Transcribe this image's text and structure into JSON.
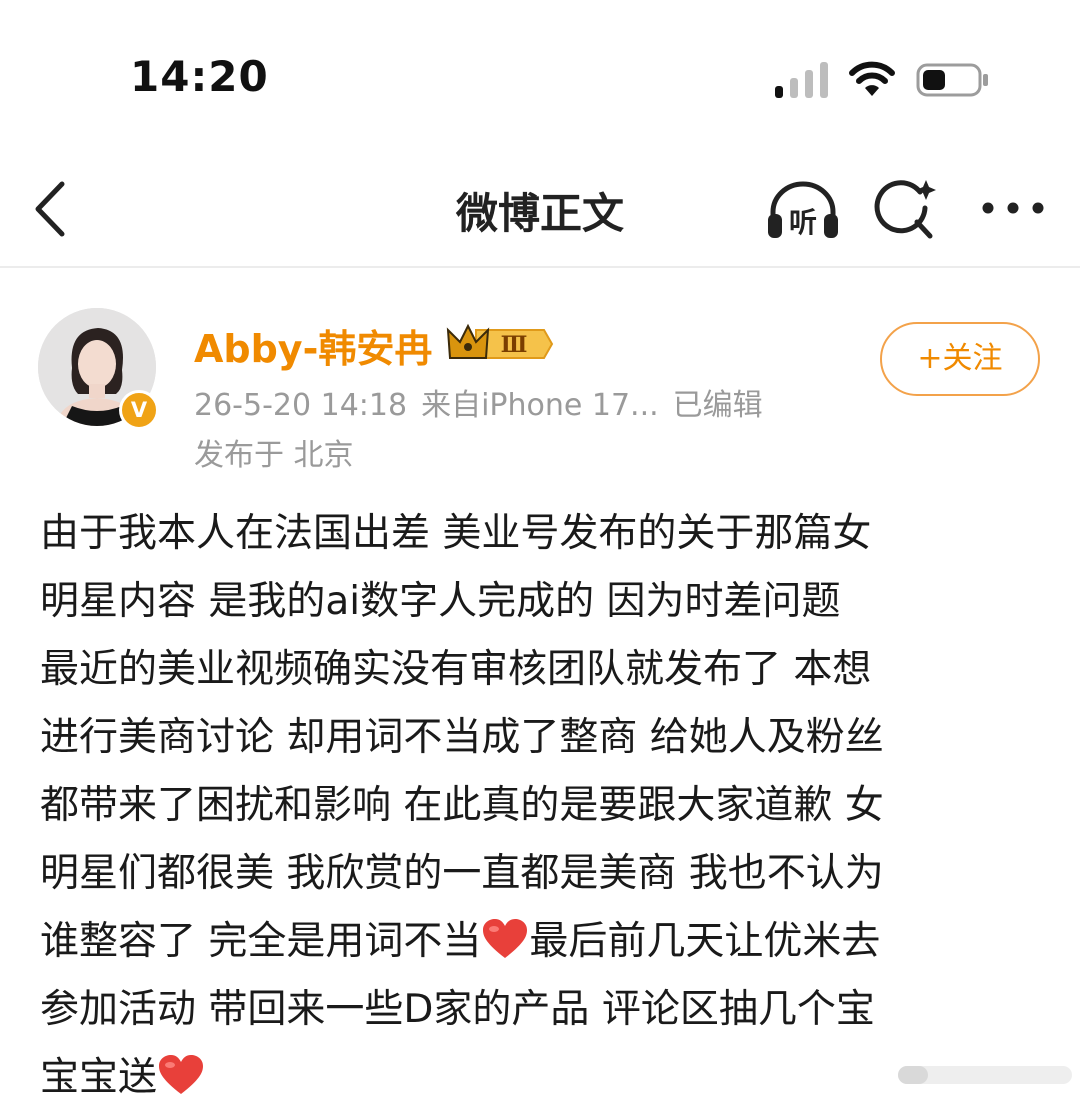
{
  "status_bar": {
    "time": "14:20"
  },
  "nav": {
    "title": "微博正文",
    "listen_label": "听"
  },
  "post": {
    "author": "Abby-韩安冉",
    "vip_level": "Ⅲ",
    "follow_label": "+关注",
    "time": "26-5-20 14:18",
    "source": "来自iPhone 17...",
    "edited": "已编辑",
    "location": "发布于 北京",
    "verified_mark": "V",
    "lines": [
      "由于我本人在法国出差 美业号发布的关于那篇女",
      "明星内容 是我的ai数字人完成的 因为时差问题",
      "最近的美业视频确实没有审核团队就发布了 本想",
      "进行美商讨论 却用词不当成了整商 给她人及粉丝",
      "都带来了困扰和影响 在此真的是要跟大家道歉 女",
      "明星们都很美 我欣赏的一直都是美商 我也不认为",
      "参加活动 带回来一些D家的产品 评论区抽几个宝"
    ],
    "line8_a": "谁整容了 完全是用词不当",
    "line8_b": "最后前几天让优米去",
    "line10": "宝宝送"
  },
  "colors": {
    "accent": "#f08a00",
    "meta": "#9a9a9a",
    "heart": "#e8403a"
  },
  "icons": [
    "back-chevron-icon",
    "headphone-icon",
    "search-icon",
    "more-icon",
    "heart-icon",
    "crown-icon"
  ]
}
